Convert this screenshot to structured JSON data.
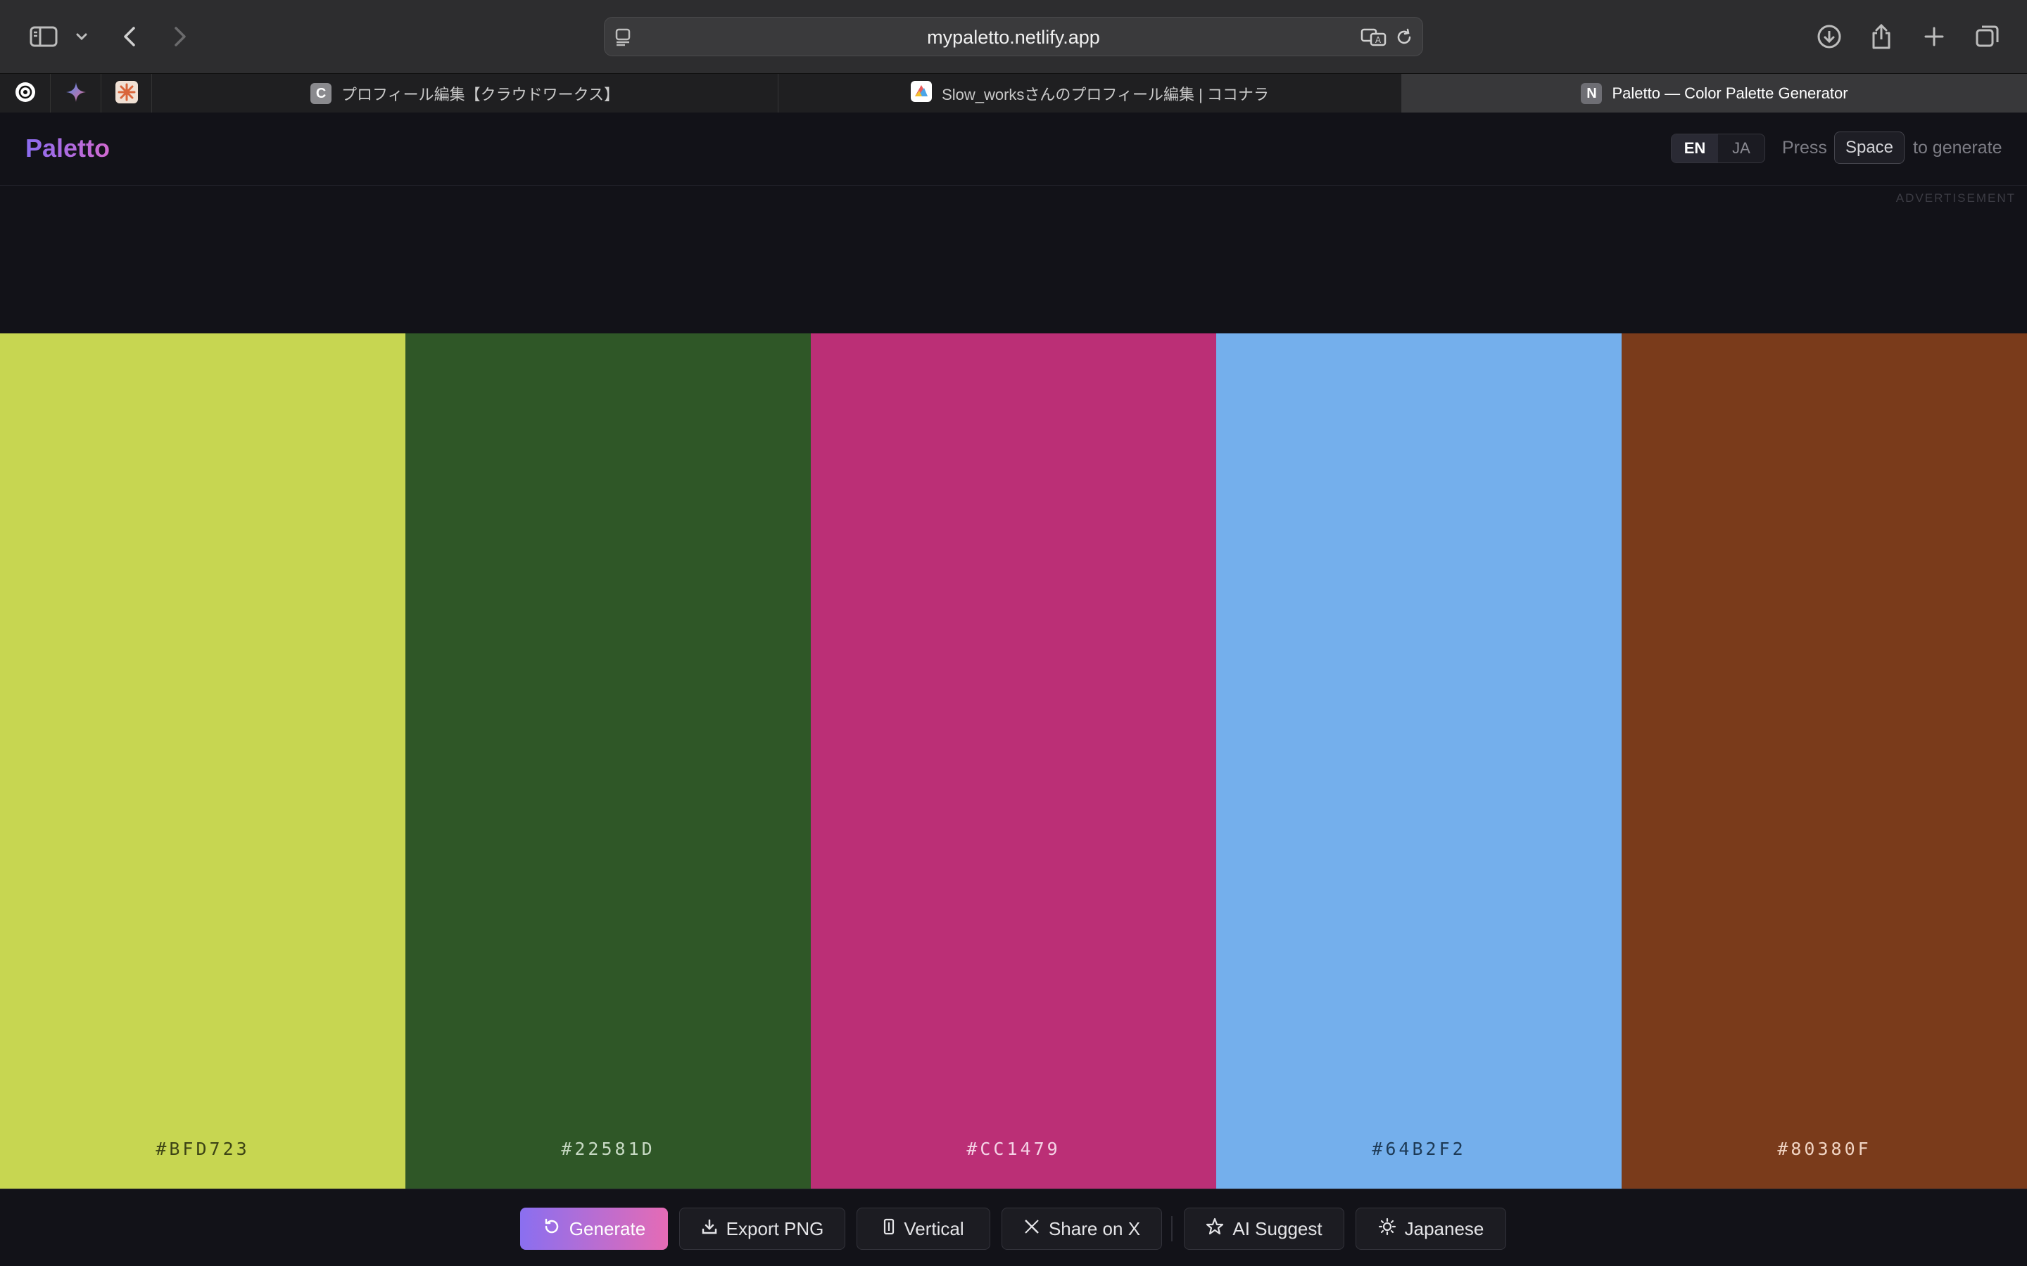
{
  "browser": {
    "url": "mypaletto.netlify.app",
    "tabs": [
      {
        "label": "プロフィール編集【クラウドワークス】",
        "favicon_letter": "C"
      },
      {
        "label": "Slow_worksさんのプロフィール編集 | ココナラ",
        "favicon_letter": ""
      },
      {
        "label": "Paletto — Color Palette Generator",
        "favicon_letter": "N"
      }
    ],
    "active_tab": 2
  },
  "app": {
    "logo": "Paletto",
    "lang": {
      "en": "EN",
      "ja": "JA",
      "selected": "EN"
    },
    "hint": {
      "press": "Press",
      "key": "Space",
      "suffix": "to generate"
    },
    "ad_label": "ADVERTISEMENT"
  },
  "palette": {
    "colors": [
      {
        "hex": "#BFD723",
        "fill": "#c7d651",
        "text_color": "#3d4415"
      },
      {
        "hex": "#22581D",
        "fill": "#2f5727",
        "text_color": "#c7d9c3"
      },
      {
        "hex": "#CC1479",
        "fill": "#bb2f76",
        "text_color": "#f5d3e6"
      },
      {
        "hex": "#64B2F2",
        "fill": "#74afec",
        "text_color": "#1d3a56"
      },
      {
        "hex": "#80380F",
        "fill": "#7a3b1b",
        "text_color": "#f0d3c2"
      }
    ]
  },
  "actions": {
    "generate": "Generate",
    "export_png": "Export PNG",
    "vertical": "Vertical",
    "share_x": "Share on X",
    "ai_suggest": "AI Suggest",
    "japanese": "Japanese"
  }
}
